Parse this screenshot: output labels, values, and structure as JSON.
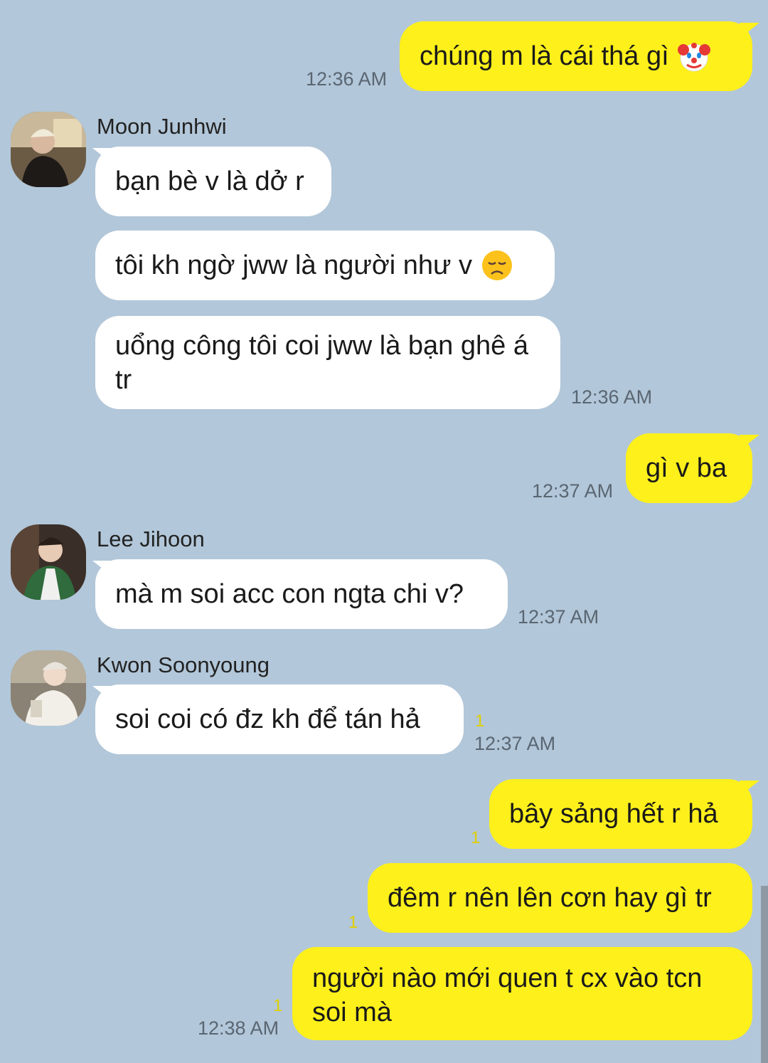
{
  "messages": [
    {
      "sender": "me",
      "text": "chúng m là cái thá gì",
      "emoji": "clown-face-icon",
      "time": "12:36 AM"
    },
    {
      "sender": "Moon Junhwi",
      "text": "bạn bè v là dở r"
    },
    {
      "sender": "Moon Junhwi",
      "text": "tôi kh ngờ jww là người như v",
      "emoji": "disappointed-face-icon"
    },
    {
      "sender": "Moon Junhwi",
      "text": "uổng công tôi coi jww là bạn ghê á tr",
      "time": "12:36 AM"
    },
    {
      "sender": "me",
      "text": "gì v ba",
      "time": "12:37 AM"
    },
    {
      "sender": "Lee Jihoon",
      "text": "mà m soi acc con ngta chi v?",
      "time": "12:37 AM"
    },
    {
      "sender": "Kwon Soonyoung",
      "text": "soi coi có đz kh để tán hả",
      "unread": "1",
      "time": "12:37 AM"
    },
    {
      "sender": "me",
      "text": "bây sảng hết r hả",
      "unread": "1"
    },
    {
      "sender": "me",
      "text": "đêm r nên lên cơn hay gì tr",
      "unread": "1"
    },
    {
      "sender": "me",
      "text": "người nào mới quen t cx vào tcn soi mà",
      "unread": "1",
      "time": "12:38 AM"
    }
  ],
  "colors": {
    "background": "#b2c7d9",
    "my_bubble": "#fef01b",
    "their_bubble": "#ffffff",
    "unread_count": "#e0cf00"
  }
}
